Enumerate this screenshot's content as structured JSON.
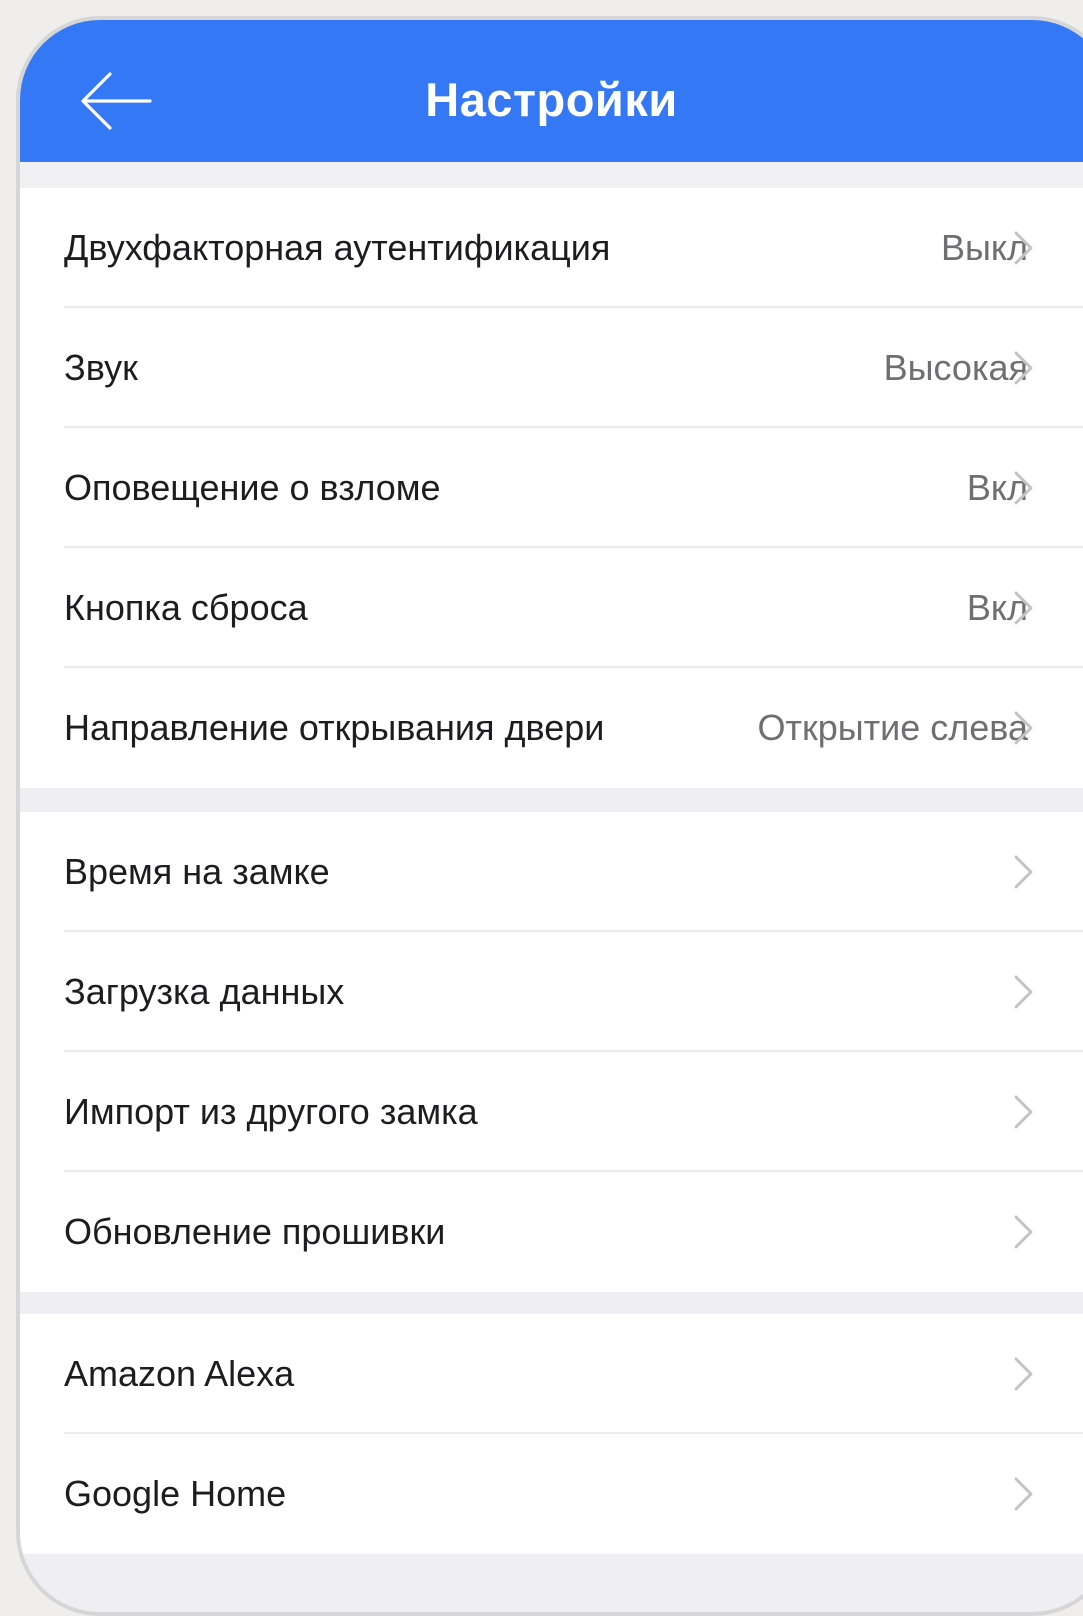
{
  "header": {
    "title": "Настройки",
    "back_icon": "arrow-left-icon",
    "background": "#3478f6"
  },
  "groups": [
    {
      "rows": [
        {
          "label": "Двухфакторная аутентификация",
          "value": "Выкл"
        },
        {
          "label": "Звук",
          "value": "Высокая"
        },
        {
          "label": "Оповещение о взломе",
          "value": "Вкл"
        },
        {
          "label": "Кнопка сброса",
          "value": "Вкл"
        },
        {
          "label": "Направление открывания двери",
          "value": "Открытие слева"
        }
      ]
    },
    {
      "rows": [
        {
          "label": "Время на замке",
          "value": ""
        },
        {
          "label": "Загрузка данных",
          "value": ""
        },
        {
          "label": "Импорт из другого замка",
          "value": ""
        },
        {
          "label": "Обновление прошивки",
          "value": ""
        }
      ]
    },
    {
      "rows": [
        {
          "label": "Amazon Alexa",
          "value": ""
        },
        {
          "label": "Google Home",
          "value": ""
        }
      ]
    }
  ],
  "icons": {
    "chevron": "chevron-right-icon"
  }
}
